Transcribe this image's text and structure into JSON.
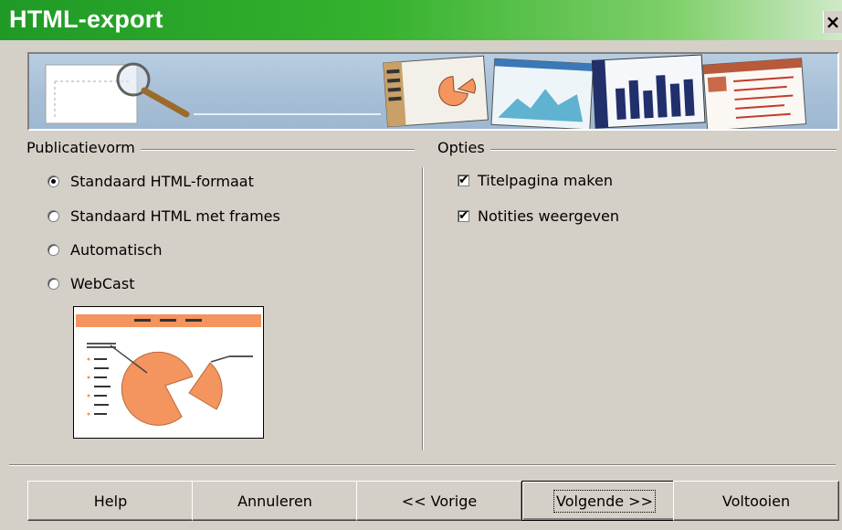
{
  "window": {
    "title": "HTML-export",
    "close_label": "×"
  },
  "publication": {
    "group_label": "Publicatievorm",
    "options": [
      {
        "label": "Standaard HTML-formaat",
        "checked": true
      },
      {
        "label": "Standaard HTML met frames",
        "checked": false
      },
      {
        "label": "Automatisch",
        "checked": false
      },
      {
        "label": "WebCast",
        "checked": false
      }
    ]
  },
  "options": {
    "group_label": "Opties",
    "items": [
      {
        "label": "Titelpagina maken",
        "checked": true
      },
      {
        "label": "Notities weergeven",
        "checked": true
      }
    ]
  },
  "buttons": {
    "help": "Help",
    "cancel": "Annuleren",
    "back": "<< Vorige",
    "next": "Volgende >>",
    "finish": "Voltooien"
  },
  "colors": {
    "title_bar": "#35b22e",
    "dialog_bg": "#d4d0c8",
    "preview_accent": "#f4945e"
  },
  "icons": {
    "check": "✔"
  }
}
